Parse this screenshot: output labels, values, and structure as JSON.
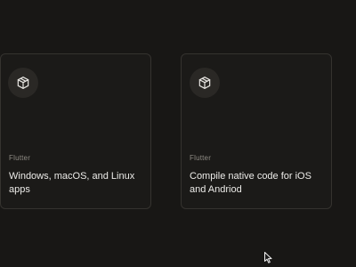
{
  "cards": [
    {
      "icon": "package-icon",
      "category": "Flutter",
      "title": "Windows, macOS, and Linux apps"
    },
    {
      "icon": "package-icon",
      "category": "Flutter",
      "title": "Compile native code for iOS and Andriod"
    }
  ],
  "colors": {
    "background": "#181715",
    "card_border": "#35332f",
    "icon_circle": "#2a2825",
    "title_text": "#ecebe8",
    "category_text": "#8f8b84"
  }
}
